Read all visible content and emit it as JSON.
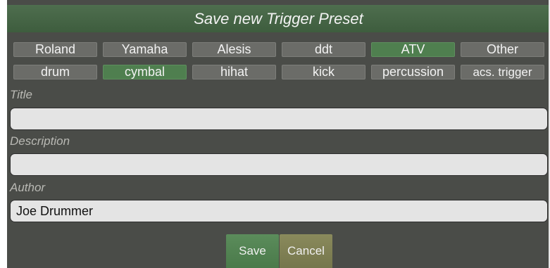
{
  "dialog": {
    "title": "Save new Trigger Preset"
  },
  "brands": {
    "items": [
      "Roland",
      "Yamaha",
      "Alesis",
      "ddt",
      "ATV",
      "Other"
    ],
    "selected": "ATV"
  },
  "types": {
    "items": [
      "drum",
      "cymbal",
      "hihat",
      "kick",
      "percussion",
      "acs. trigger"
    ],
    "selected": "cymbal"
  },
  "fields": {
    "title": {
      "label": "Title",
      "value": ""
    },
    "description": {
      "label": "Description",
      "value": ""
    },
    "author": {
      "label": "Author",
      "value": "Joe Drummer"
    }
  },
  "actions": {
    "save_label": "Save",
    "cancel_label": "Cancel"
  },
  "colors": {
    "header": "#466646",
    "panel": "#4a4c48",
    "chip": "#6b6c68",
    "chip_selected": "#4f7f4f",
    "save": "#548554",
    "cancel": "#807f54"
  }
}
